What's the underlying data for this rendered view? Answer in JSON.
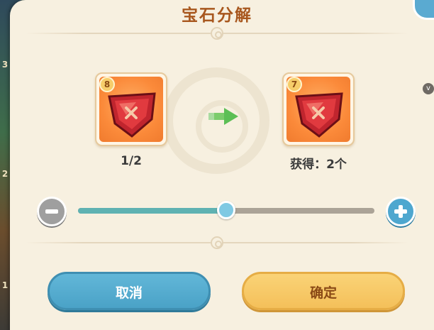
{
  "title": "宝石分解",
  "background_numbers": [
    "3",
    "2",
    "1"
  ],
  "source_gem": {
    "level": "8",
    "count_text": "1/2",
    "icon": "red-gem-icon"
  },
  "result_gem": {
    "level": "7",
    "obtain_text": "获得：2个",
    "icon": "red-gem-icon"
  },
  "slider": {
    "value_fraction": 0.5,
    "minus_icon": "minus-icon",
    "plus_icon": "plus-icon"
  },
  "buttons": {
    "cancel": "取消",
    "confirm": "确定"
  },
  "side_badge": "v",
  "colors": {
    "panel": "#f7f0e0",
    "title": "#a8571e",
    "cancel": "#4aa2c7",
    "confirm": "#f4c05a",
    "slider_fill": "#5fb2b2",
    "slider_track": "#aba397"
  }
}
